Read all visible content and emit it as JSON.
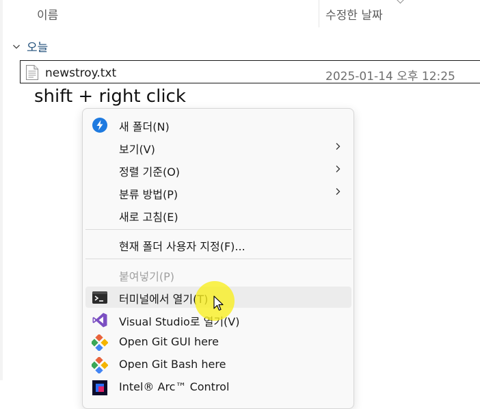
{
  "columns": {
    "name": "이름",
    "modified": "수정한 날짜"
  },
  "group": {
    "label": "오늘"
  },
  "file": {
    "name": "newstroy.txt",
    "modified": "2025-01-14 오후 12:25"
  },
  "annotation": "shift + right click",
  "menu": {
    "new_folder": "새 폴더(N)",
    "view": "보기(V)",
    "sort_by": "정렬 기준(O)",
    "group_by": "분류 방법(P)",
    "refresh": "새로 고침(E)",
    "customize": "현재 폴더 사용자 지정(F)...",
    "paste": "붙여넣기(P)",
    "terminal": "터미널에서 열기(T)",
    "visual_studio": "Visual Studio로 열기(V)",
    "git_gui": "Open Git GUI here",
    "git_bash": "Open Git Bash here",
    "intel_arc": "Intel® Arc™ Control"
  },
  "colors": {
    "accent_blue": "#1e7ae0",
    "group_blue": "#1f4e79",
    "vs_purple": "#7b4fc2",
    "git_orange": "#e8623a",
    "highlight_yellow": "#f8ee1e"
  }
}
